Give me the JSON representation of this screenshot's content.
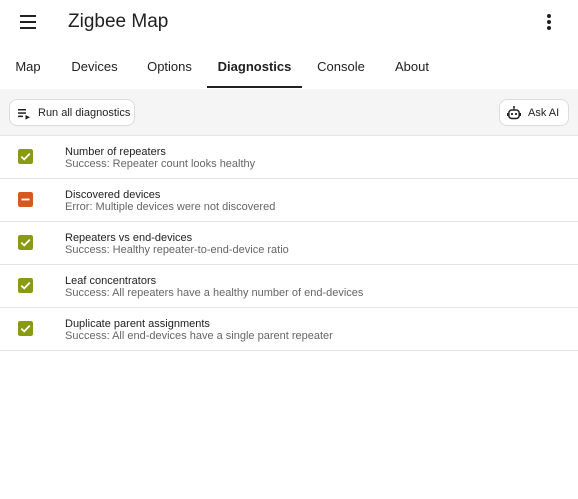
{
  "app": {
    "title": "Zigbee Map"
  },
  "icons": {
    "menu": "menu-icon",
    "more": "more-vert-icon",
    "run": "playlist-play-icon",
    "ai": "robot-icon"
  },
  "tabs": [
    {
      "label": "Map",
      "active": false
    },
    {
      "label": "Devices",
      "active": false
    },
    {
      "label": "Options",
      "active": false
    },
    {
      "label": "Diagnostics",
      "active": true
    },
    {
      "label": "Console",
      "active": false
    },
    {
      "label": "About",
      "active": false
    }
  ],
  "toolbar": {
    "run_label": "Run all diagnostics",
    "ai_label": "Ask AI"
  },
  "colors": {
    "success": "#8a9a13",
    "error": "#d65a20",
    "divider": "#e4e4e4",
    "toolbar_bg": "#f5f5f5"
  },
  "diagnostics": [
    {
      "title": "Number of repeaters",
      "detail": "Success: Repeater count looks healthy",
      "status": "success"
    },
    {
      "title": "Discovered devices",
      "detail": "Error: Multiple devices were not discovered",
      "status": "error"
    },
    {
      "title": "Repeaters vs end-devices",
      "detail": "Success: Healthy repeater-to-end-device ratio",
      "status": "success"
    },
    {
      "title": "Leaf concentrators",
      "detail": "Success: All repeaters have a healthy number of end-devices",
      "status": "success"
    },
    {
      "title": "Duplicate parent assignments",
      "detail": "Success: All end-devices have a single parent repeater",
      "status": "success"
    }
  ]
}
